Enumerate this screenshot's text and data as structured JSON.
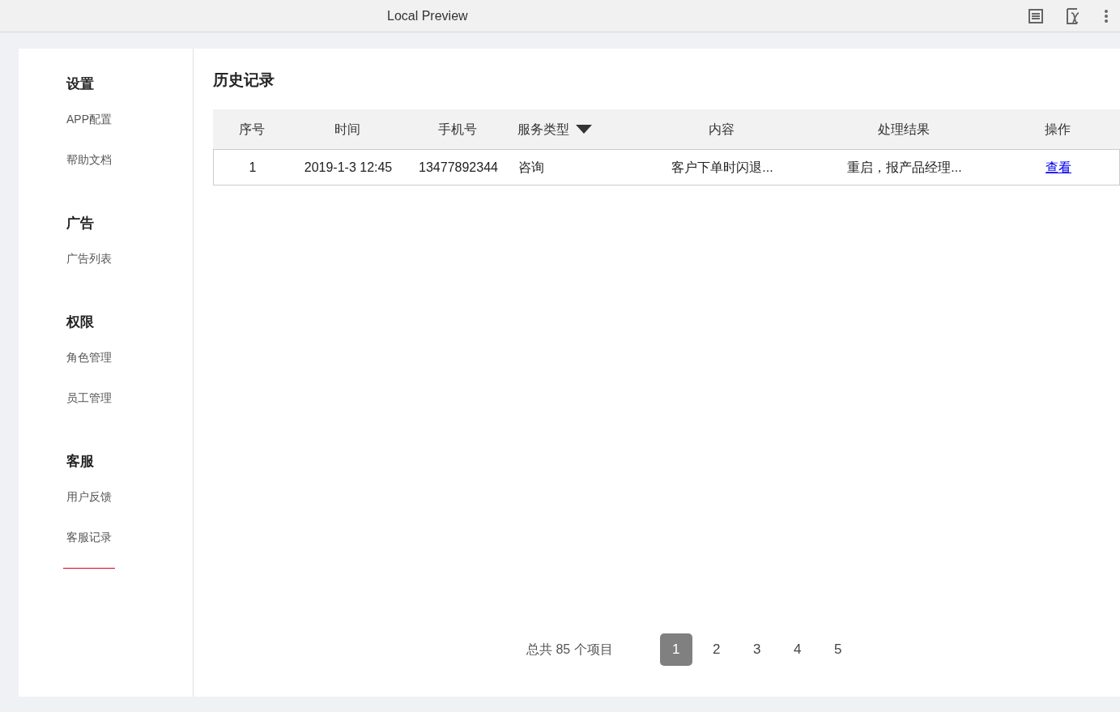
{
  "window": {
    "title": "Local Preview"
  },
  "sidebar": {
    "sections": [
      {
        "title": "设置",
        "items": [
          {
            "label": "APP配置",
            "selected": false
          },
          {
            "label": "帮助文档",
            "selected": false
          }
        ]
      },
      {
        "title": "广告",
        "items": [
          {
            "label": "广告列表",
            "selected": false
          }
        ]
      },
      {
        "title": "权限",
        "items": [
          {
            "label": "角色管理",
            "selected": false
          },
          {
            "label": "员工管理",
            "selected": false
          }
        ]
      },
      {
        "title": "客服",
        "items": [
          {
            "label": "用户反馈",
            "selected": false
          },
          {
            "label": "客服记录",
            "selected": true
          }
        ]
      }
    ]
  },
  "page_title": "历史记录",
  "table": {
    "columns": [
      {
        "label": "序号",
        "sortable": false
      },
      {
        "label": "时间",
        "sortable": false
      },
      {
        "label": "手机号",
        "sortable": false
      },
      {
        "label": "服务类型",
        "sortable": true
      },
      {
        "label": "内容",
        "sortable": false
      },
      {
        "label": "处理结果",
        "sortable": false
      },
      {
        "label": "操作",
        "sortable": false
      }
    ],
    "rows": [
      {
        "cells": [
          "1",
          "2019-1-3 12:45",
          "13477892344",
          "咨询",
          "客户下单时闪退...",
          "重启，报产品经理..."
        ],
        "action": "查看"
      }
    ]
  },
  "pagination": {
    "total": "总共 85 个项目",
    "pages": [
      {
        "label": "1",
        "selected": true
      },
      {
        "label": "2",
        "selected": false
      },
      {
        "label": "3",
        "selected": false
      },
      {
        "label": "4",
        "selected": false
      },
      {
        "label": "5",
        "selected": false
      }
    ]
  }
}
